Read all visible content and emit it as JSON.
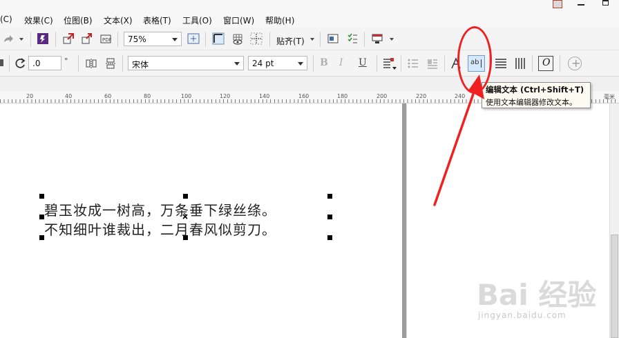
{
  "menu": {
    "items": [
      {
        "label": "(C)"
      },
      {
        "label": "效果(C)"
      },
      {
        "label": "位图(B)"
      },
      {
        "label": "文本(X)"
      },
      {
        "label": "表格(T)"
      },
      {
        "label": "工具(O)"
      },
      {
        "label": "窗口(W)"
      },
      {
        "label": "帮助(H)"
      }
    ]
  },
  "toolbar": {
    "zoom_value": "75%",
    "snap_label": "贴齐(T)"
  },
  "text_toolbar": {
    "rotation_value": ".0",
    "degree_symbol": "°",
    "font_name": "宋体",
    "font_size": "24 pt",
    "bold_glyph": "B",
    "italic_glyph": "I",
    "underline_glyph": "U",
    "edit_text_glyph": "ab",
    "frame_glyph": "O",
    "add_glyph": "+"
  },
  "ruler": {
    "labels": [
      "20",
      "40",
      "60",
      "80",
      "100",
      "120",
      "140",
      "160",
      "180",
      "200",
      "220",
      "240"
    ],
    "unit": "毫米"
  },
  "tooltip": {
    "title": "编辑文本 (Ctrl+Shift+T)",
    "description": "使用文本编辑器修改文本。"
  },
  "document": {
    "line1": "碧玉妆成一树高，万条垂下绿丝绦。",
    "line2": "不知细叶谁裁出，二月春风似剪刀。"
  },
  "watermark": {
    "brand": "Bai 经验",
    "url": "jingyan.baidu.com"
  },
  "colors": {
    "annotation": "#f02020",
    "accent": "#3a7bd5",
    "pdf_icon": "#5a2a82"
  }
}
